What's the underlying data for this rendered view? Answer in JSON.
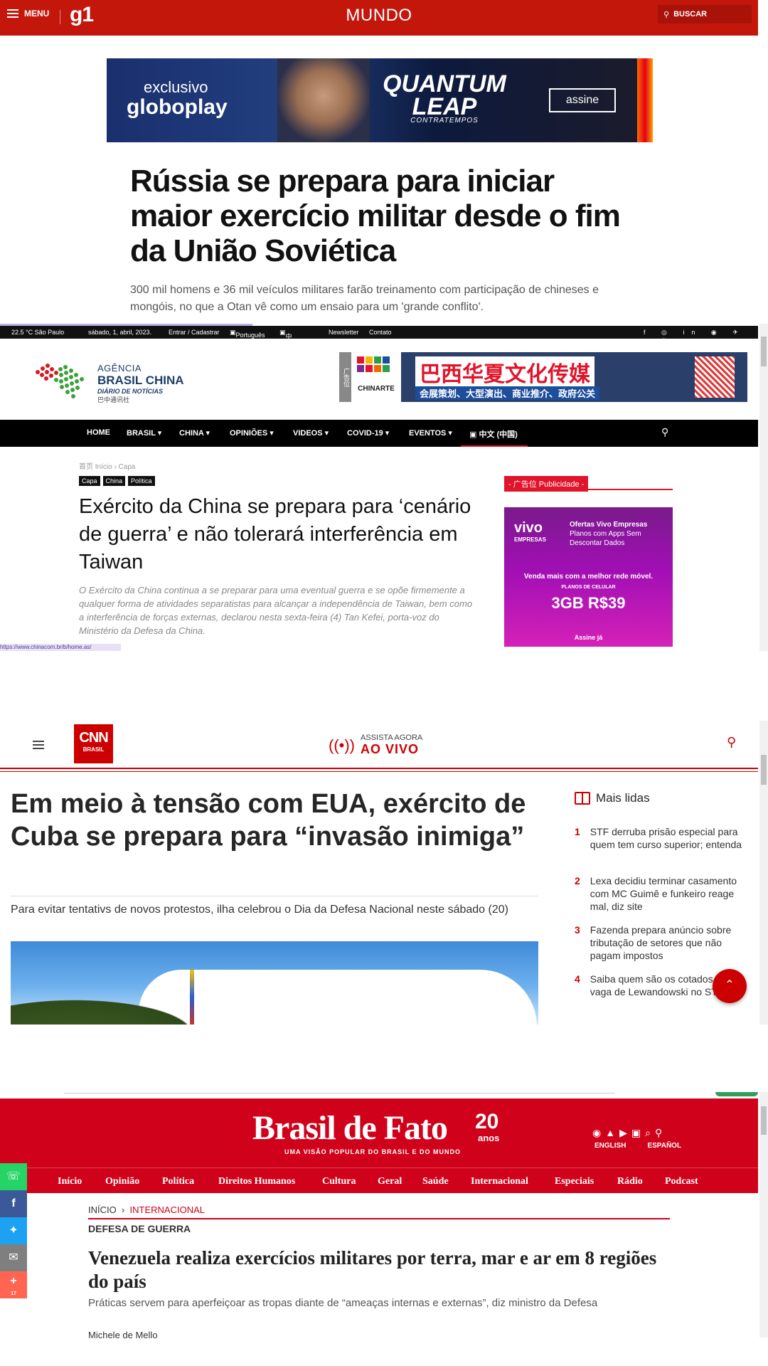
{
  "g1": {
    "menu_label": "MENU",
    "logo": "g1",
    "section": "MUNDO",
    "search_label": "BUSCAR",
    "ad": {
      "line1": "exclusivo",
      "line2": "globoplay",
      "title": "QUANTUM LEAP",
      "subtitle": "CONTRATEMPOS",
      "cta": "assine"
    },
    "headline": "Rússia se prepara para iniciar maior exercício militar desde o fim da União Soviética",
    "subheadline": "300 mil homens e 36 mil veículos militares farão treinamento com participação de chineses e mongóis, no que a Otan vê como um ensaio para um 'grande conflito'."
  },
  "abc": {
    "topbar": {
      "weather": "22.5 °C São Paulo",
      "date": "sábado, 1, abril, 2023.",
      "login": "Entrar / Cadastrar",
      "lang_pt": "Português",
      "lang_cn": "中文 (中国)",
      "newsletter": "Newsletter",
      "contact": "Contato"
    },
    "logo": {
      "line1": "AGÊNCIA",
      "line2": "BRASIL CHINA",
      "line3": "DIÁRIO DE NOTÍCIAS",
      "line4": "巴中通讯社"
    },
    "banner": {
      "ad_tag": "广告位",
      "chinarte": "CHINARTE",
      "title_cn": "巴西华夏文化传媒",
      "sub_cn": "会展策划、大型演出、商业推介、政府公关"
    },
    "nav": [
      "HOME",
      "BRASIL",
      "CHINA",
      "OPINIÕES",
      "VIDEOS",
      "COVID-19",
      "EVENTOS",
      "中文 (中国)"
    ],
    "breadcrumb": "首页 Início  ›  Capa",
    "tags": [
      "Capa",
      "China",
      "Política"
    ],
    "headline": "Exército da China se prepara para ‘cenário de guerra’ e não tolerará interferência em Taiwan",
    "lead": "O Exército da China continua a se preparar para uma eventual guerra e se opõe firmemente a qualquer forma de atividades separatistas para alcançar a independência de Taiwan, bem como a interferência de forças externas, declarou nesta sexta-feira (4) Tan Kefei, porta-voz do Ministério da Defesa da China.",
    "publicidade": "- 广告位 Publicidade -",
    "side_ad": {
      "brand": "vivo",
      "brand_sub": "EMPRESAS",
      "offer_title": "Ofertas Vivo Empresas",
      "offer_text": "Planos com Apps Sem Descontar Dados",
      "mid": "Venda mais com a melhor rede móvel.",
      "plan_label": "PLANOS DE CELULAR",
      "price": "3GB  R$39",
      "cta": "Assine já"
    },
    "status_url": "https://www.chinacom.br/b/home.as/"
  },
  "cnn": {
    "logo_main": "CNN",
    "logo_sub": "BRASIL",
    "live_top": "ASSISTA AGORA",
    "live_main": "AO VIVO",
    "headline": "Em meio à tensão com EUA, exército de Cuba se prepara para “invasão inimiga”",
    "subheadline": "Para evitar tentativs de novos protestos, ilha celebrou o Dia da Defesa Nacional neste sábado (20)",
    "sidebar_title": "Mais lidas",
    "most_read": [
      {
        "n": "1",
        "text": "STF derruba prisão especial para quem tem curso superior; entenda"
      },
      {
        "n": "2",
        "text": "Lexa decidiu terminar casamento com MC Guimê e funkeiro reage mal, diz site"
      },
      {
        "n": "3",
        "text": "Fazenda prepara anúncio sobre tributação de setores que não pagam impostos"
      },
      {
        "n": "4",
        "text": "Saiba quem são os cotados para a vaga de Lewandowski no STF"
      }
    ]
  },
  "bdf": {
    "logo": "Brasil de Fato",
    "twenty": "20",
    "anos": "anos",
    "tagline": "UMA VISÃO POPULAR DO BRASIL E DO MUNDO",
    "lang_en": "ENGLISH",
    "lang_es": "ESPAÑOL",
    "nav": [
      "Início",
      "Opinião",
      "Política",
      "Direitos Humanos",
      "Cultura",
      "Geral",
      "Saúde",
      "Internacional",
      "Especiais",
      "Rádio",
      "Podcast"
    ],
    "crumb_home": "INÍCIO",
    "crumb_section": "INTERNACIONAL",
    "hat": "DEFESA DE GUERRA",
    "headline": "Venezuela realiza exercícios militares por terra, mar e ar em 8 regiões do país",
    "subheadline": "Práticas servem para aperfeiçoar as tropas diante de “ameaças internas e externas”, diz ministro da Defesa",
    "author": "Michele de Mello",
    "share_count": "17"
  },
  "colors": {
    "g1_red": "#c4170c",
    "cnn_red": "#cc0000",
    "bdf_red": "#d0021b",
    "abc_nav": "#000000"
  }
}
